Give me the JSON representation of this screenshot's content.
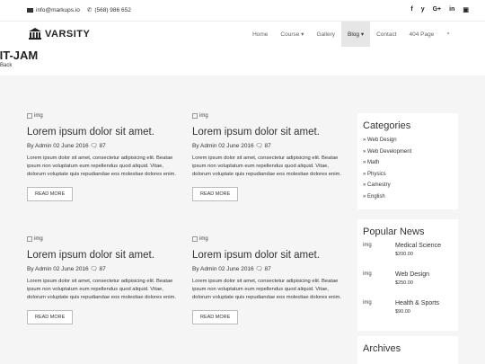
{
  "topbar": {
    "email": "info@markups.io",
    "phone": "(568) 986 652",
    "social": [
      "f",
      "y",
      "G+",
      "in"
    ]
  },
  "nav": {
    "brand": "VARSITY",
    "items": [
      "Home",
      "Course ▾",
      "Gallery",
      "Blog ▾",
      "Contact",
      "404 Page"
    ],
    "active_index": 3
  },
  "page": {
    "title": "IIT-JAM",
    "breadcrumb": "Back"
  },
  "posts": [
    {
      "img_alt": "img",
      "title": "Lorem ipsum dolor sit amet.",
      "meta": "By Admin  02 June 2016  🗨 87",
      "excerpt": "Lorem ipsum dolor sit amet, consectetur adipisicing elit. Beatae ipsum non voluptatum eum repellendus quod aliquid. Vitae, dolorum voluptate quis repudiandae eos molestiae dolores enim.",
      "more": "READ MORE"
    },
    {
      "img_alt": "img",
      "title": "Lorem ipsum dolor sit amet.",
      "meta": "By Admin  02 June 2016  🗨 87",
      "excerpt": "Lorem ipsum dolor sit amet, consectetur adipisicing elit. Beatae ipsum non voluptatum eum repellendus quod aliquid. Vitae, dolorum voluptate quis repudiandae eos molestiae dolores enim.",
      "more": "READ MORE"
    },
    {
      "img_alt": "img",
      "title": "Lorem ipsum dolor sit amet.",
      "meta": "By Admin  02 June 2016  🗨 87",
      "excerpt": "Lorem ipsum dolor sit amet, consectetur adipisicing elit. Beatae ipsum non voluptatum eum repellendus quod aliquid. Vitae, dolorum voluptate quis repudiandae eos molestiae dolores enim.",
      "more": "READ MORE"
    },
    {
      "img_alt": "img",
      "title": "Lorem ipsum dolor sit amet.",
      "meta": "By Admin  02 June 2016  🗨 87",
      "excerpt": "Lorem ipsum dolor sit amet, consectetur adipisicing elit. Beatae ipsum non voluptatum eum repellendus quod aliquid. Vitae, dolorum voluptate quis repudiandae eos molestiae dolores enim.",
      "more": "READ MORE"
    }
  ],
  "categories": {
    "title": "Categories",
    "items": [
      "» Web Design",
      "» Web Development",
      "» Math",
      "» Physics",
      "» Camestry",
      "» English"
    ]
  },
  "popular": {
    "title": "Popular News",
    "items": [
      {
        "img_alt": "img",
        "name": "Medical Science",
        "price": "$200.00"
      },
      {
        "img_alt": "img",
        "name": "Web Design",
        "price": "$250.00"
      },
      {
        "img_alt": "img",
        "name": "Health & Sports",
        "price": "$90.00"
      }
    ]
  },
  "archives": {
    "title": "Archives"
  }
}
